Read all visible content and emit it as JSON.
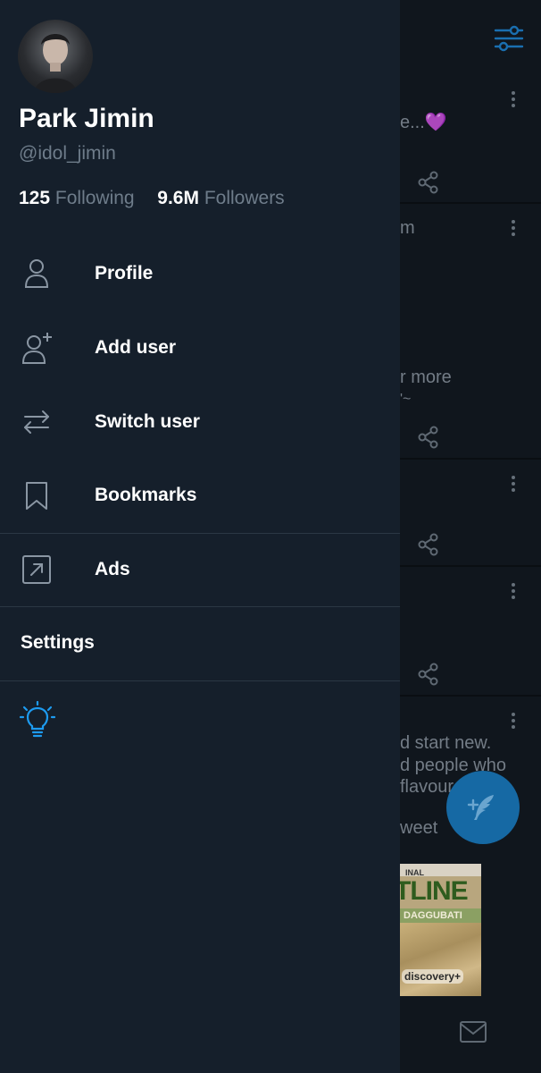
{
  "profile": {
    "name": "Park Jimin",
    "handle": "@idol_jimin",
    "following_count": "125",
    "following_label": "Following",
    "followers_count": "9.6M",
    "followers_label": "Followers"
  },
  "menu": {
    "profile": "Profile",
    "add_user": "Add user",
    "switch_user": "Switch user",
    "bookmarks": "Bookmarks",
    "ads": "Ads",
    "settings": "Settings"
  },
  "background_feed": {
    "snippet_1": "e...💜",
    "snippet_2": "m",
    "snippet_3": "r more",
    "snippet_4": "'~",
    "snippet_5": "d start new.",
    "snippet_6": "d people who",
    "snippet_7": "flavour",
    "snippet_8": "weet",
    "ad": {
      "top_text": "INAL",
      "title": "TLINE",
      "band_text": "DAGGUBATI",
      "brand": "discovery+"
    }
  },
  "colors": {
    "drawer_bg": "#151f2b",
    "accent": "#1d9bf0",
    "fab": "#1669a4",
    "muted": "#6e7c8a"
  }
}
